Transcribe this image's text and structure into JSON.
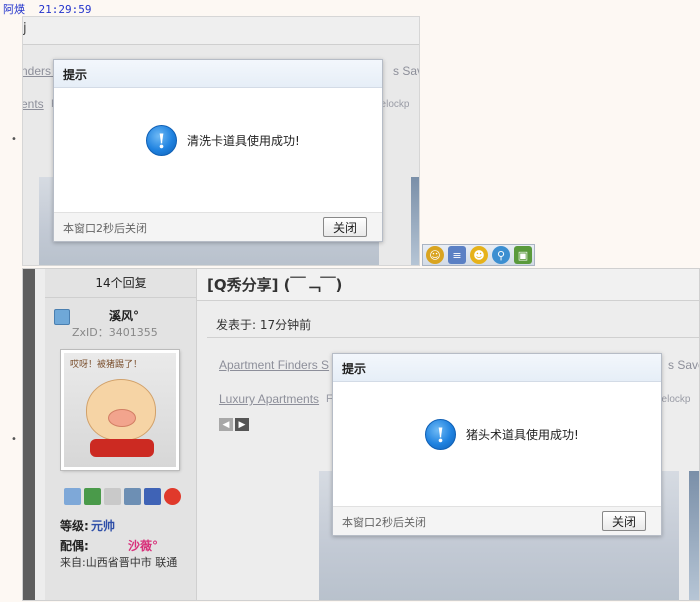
{
  "chat": {
    "sender": "阿煐",
    "time": "21:29:59"
  },
  "screenshot1": {
    "fragment_top": "j",
    "link_finders": "nders S",
    "link_apartments": "ents",
    "link_save": "s Save",
    "link_lock": "eelockp",
    "faint_f": "F",
    "dialog": {
      "title": "提示",
      "message": "清洗卡道具使用成功!",
      "auto_close": "本窗口2秒后关闭",
      "close_label": "关闭"
    }
  },
  "toolbar": {
    "icons": [
      "smile-icon",
      "note-icon",
      "emoji-icon",
      "search-user-icon",
      "image-icon"
    ]
  },
  "screenshot2": {
    "replies": "14个回复",
    "thread_title": "[Q秀分享] (￣﹁￣)",
    "username": "溪风°",
    "zxid": "ZxID：3401355",
    "avatar_caption": "哎呀！被猪踢了！",
    "rank_label": "等级:",
    "rank_value": "元帅",
    "spouse_label": "配偶:",
    "spouse_value": "沙薇°",
    "from_text": "来自:山西省晋中市 联通",
    "posted": "发表于: 17分钟前",
    "link_apartment_finders": "Apartment Finders S",
    "link_luxury": "Luxury Apartments",
    "faint_f": "F",
    "link_save": "s Save",
    "link_lock": "eelockp",
    "dialog": {
      "title": "提示",
      "message": "猪头术道具使用成功!",
      "auto_close": "本窗口2秒后关闭",
      "close_label": "关闭"
    }
  },
  "colors": {
    "accent_blue": "#1f82e0",
    "rank_blue": "#2f4fa8",
    "spouse_pink": "#d8307a"
  }
}
